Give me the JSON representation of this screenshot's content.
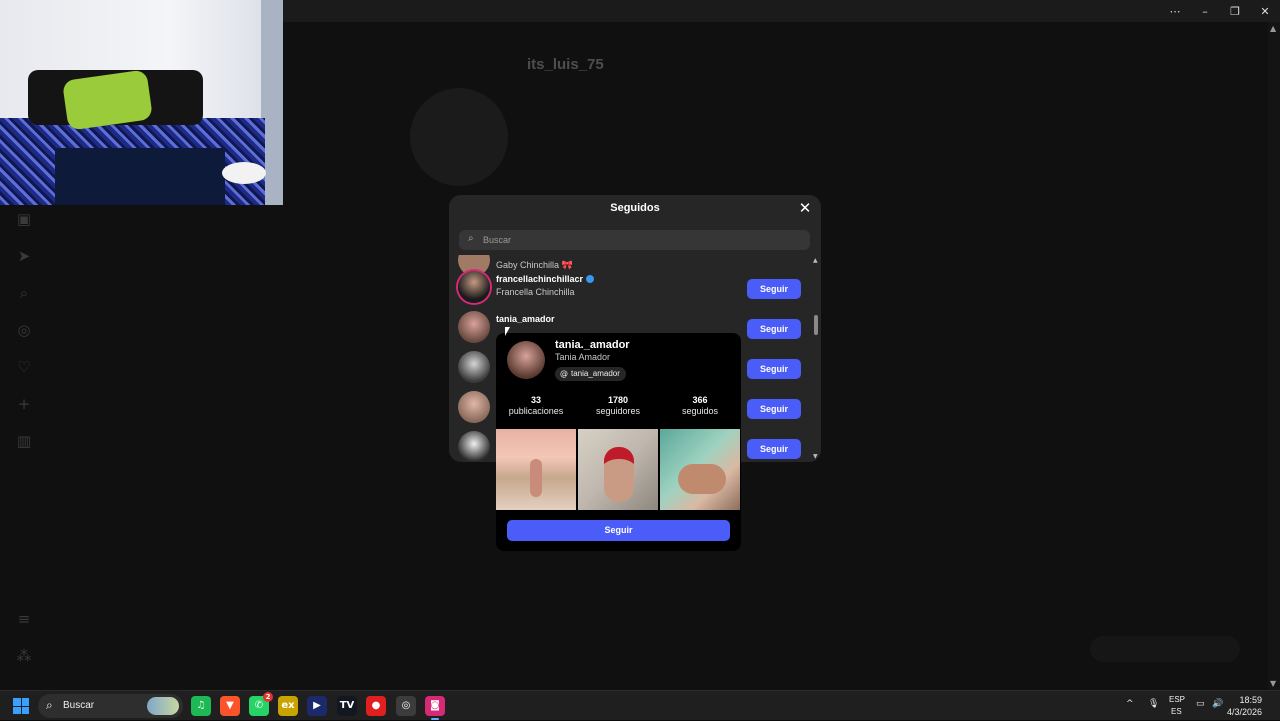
{
  "window": {
    "controls": [
      "⋯",
      "–",
      "❐",
      "✕"
    ]
  },
  "background_profile": {
    "username": "its_luis_75"
  },
  "modal": {
    "title": "Seguidos",
    "search_placeholder": "Buscar",
    "rows": [
      {
        "username": "",
        "fullname": "Gaby Chinchilla 🎀",
        "button": ""
      },
      {
        "username": "francellachinchillacr",
        "fullname": "Francella Chinchilla",
        "verified": true,
        "button": "Seguir"
      },
      {
        "username": "tania_amador",
        "fullname": "",
        "button": "Seguir"
      },
      {
        "username": "",
        "fullname": "",
        "button": "Seguir"
      },
      {
        "username": "",
        "fullname": "",
        "button": "Seguir"
      },
      {
        "username": "",
        "fullname": "",
        "button": "Seguir"
      }
    ]
  },
  "hover_card": {
    "username": "tania._amador",
    "fullname": "Tania Amador",
    "threads_handle": "tania_amador",
    "stats": [
      {
        "value": "33",
        "label": "publicaciones"
      },
      {
        "value": "1780",
        "label": "seguidores"
      },
      {
        "value": "366",
        "label": "seguidos"
      }
    ],
    "follow_button": "Seguir"
  },
  "taskbar": {
    "search_label": "Buscar",
    "apps": [
      {
        "name": "spotify",
        "glyph": "♫",
        "color": "#1db954"
      },
      {
        "name": "brave",
        "glyph": "▼",
        "color": "#fb542b"
      },
      {
        "name": "whatsapp",
        "glyph": "✆",
        "color": "#25d366",
        "badge": "2"
      },
      {
        "name": "excel-app",
        "glyph": "ex",
        "color": "#c9a400"
      },
      {
        "name": "terminal",
        "glyph": "▶",
        "color": "#1b2a6b"
      },
      {
        "name": "tradingview",
        "glyph": "TV",
        "color": "#131722"
      },
      {
        "name": "recorder",
        "glyph": "●",
        "color": "#e02020"
      },
      {
        "name": "chrome",
        "glyph": "◎",
        "color": "#3c3c3c"
      },
      {
        "name": "instagram",
        "glyph": "◙",
        "color": "#d62976",
        "active": true
      }
    ],
    "tray": {
      "lang_1": "ESP",
      "lang_2": "ES",
      "time": "18:59",
      "date": "4/3/2026"
    }
  }
}
